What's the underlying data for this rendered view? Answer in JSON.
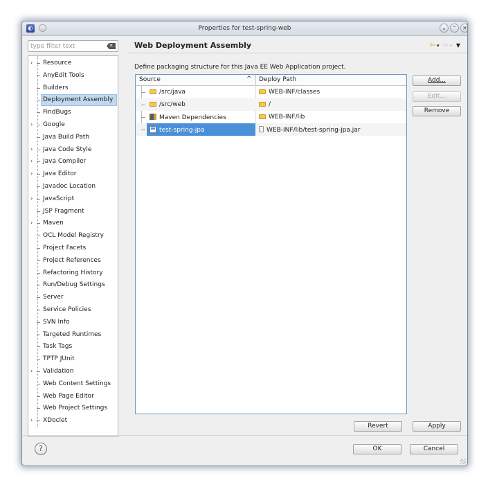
{
  "window": {
    "title": "Properties for test-spring-web",
    "app_icon": "eclipse-icon",
    "controls": [
      "minimize-icon",
      "maximize-icon",
      "close-icon"
    ]
  },
  "filter": {
    "placeholder": "type filter text",
    "clear_icon": "clear-icon"
  },
  "tree": {
    "items": [
      {
        "label": "Resource",
        "expandable": true
      },
      {
        "label": "AnyEdit Tools",
        "expandable": false
      },
      {
        "label": "Builders",
        "expandable": false
      },
      {
        "label": "Deployment Assembly",
        "expandable": false,
        "selected": true
      },
      {
        "label": "FindBugs",
        "expandable": false
      },
      {
        "label": "Google",
        "expandable": true
      },
      {
        "label": "Java Build Path",
        "expandable": false
      },
      {
        "label": "Java Code Style",
        "expandable": true
      },
      {
        "label": "Java Compiler",
        "expandable": true
      },
      {
        "label": "Java Editor",
        "expandable": true
      },
      {
        "label": "Javadoc Location",
        "expandable": false
      },
      {
        "label": "JavaScript",
        "expandable": true
      },
      {
        "label": "JSP Fragment",
        "expandable": false
      },
      {
        "label": "Maven",
        "expandable": true
      },
      {
        "label": "OCL Model Registry",
        "expandable": false
      },
      {
        "label": "Project Facets",
        "expandable": false
      },
      {
        "label": "Project References",
        "expandable": false
      },
      {
        "label": "Refactoring History",
        "expandable": false
      },
      {
        "label": "Run/Debug Settings",
        "expandable": false
      },
      {
        "label": "Server",
        "expandable": false
      },
      {
        "label": "Service Policies",
        "expandable": false
      },
      {
        "label": "SVN Info",
        "expandable": false
      },
      {
        "label": "Targeted Runtimes",
        "expandable": false
      },
      {
        "label": "Task Tags",
        "expandable": false
      },
      {
        "label": "TPTP JUnit",
        "expandable": false
      },
      {
        "label": "Validation",
        "expandable": true
      },
      {
        "label": "Web Content Settings",
        "expandable": false
      },
      {
        "label": "Web Page Editor",
        "expandable": false
      },
      {
        "label": "Web Project Settings",
        "expandable": false
      },
      {
        "label": "XDoclet",
        "expandable": true
      }
    ]
  },
  "page": {
    "heading": "Web Deployment Assembly",
    "description": "Define packaging structure for this Java EE Web Application project.",
    "nav_icons": [
      "back-arrow-icon",
      "dropdown-icon",
      "forward-arrow-icon",
      "dropdown-icon",
      "menu-icon"
    ]
  },
  "table": {
    "columns": [
      "Source",
      "Deploy Path"
    ],
    "rows": [
      {
        "source": "/src/java",
        "source_icon": "folder-icon",
        "deploy": "WEB-INF/classes",
        "deploy_icon": "folder-icon"
      },
      {
        "source": "/src/web",
        "source_icon": "folder-icon",
        "deploy": "/",
        "deploy_icon": "folder-icon"
      },
      {
        "source": "Maven Dependencies",
        "source_icon": "library-icon",
        "deploy": "WEB-INF/lib",
        "deploy_icon": "folder-icon"
      },
      {
        "source": "test-spring-jpa",
        "source_icon": "project-icon",
        "deploy": "WEB-INF/lib/test-spring-jpa.jar",
        "deploy_icon": "jar-icon",
        "selected": true
      }
    ]
  },
  "buttons": {
    "add": "Add...",
    "edit": "Edit...",
    "remove": "Remove",
    "revert": "Revert",
    "apply": "Apply",
    "ok": "OK",
    "cancel": "Cancel",
    "help": "?"
  },
  "colors": {
    "selection": "#4a90d9",
    "tree_selection": "#c1d8ee",
    "table_border": "#6e95c4"
  }
}
